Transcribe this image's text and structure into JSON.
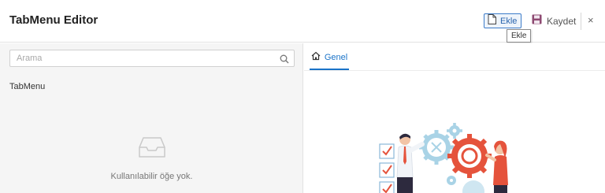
{
  "header": {
    "title": "TabMenu Editor",
    "add_label": "Ekle",
    "save_label": "Kaydet",
    "close_label": "×",
    "tooltip": "Ekle"
  },
  "sidebar": {
    "search_placeholder": "Arama",
    "tree_root": "TabMenu",
    "empty_text": "Kullanılabilir öğe yok."
  },
  "main": {
    "tabs": [
      {
        "label": "Genel",
        "active": true
      }
    ]
  },
  "colors": {
    "accent": "#1a73c8",
    "save_icon": "#8e4a72",
    "gear_red": "#e5533c",
    "gear_blue": "#a9d3e6"
  },
  "icons": {
    "add": "new-document-icon",
    "save": "floppy-disk-icon",
    "close": "close-icon",
    "search": "search-icon",
    "tab": "home-icon",
    "empty": "empty-inbox-icon"
  }
}
